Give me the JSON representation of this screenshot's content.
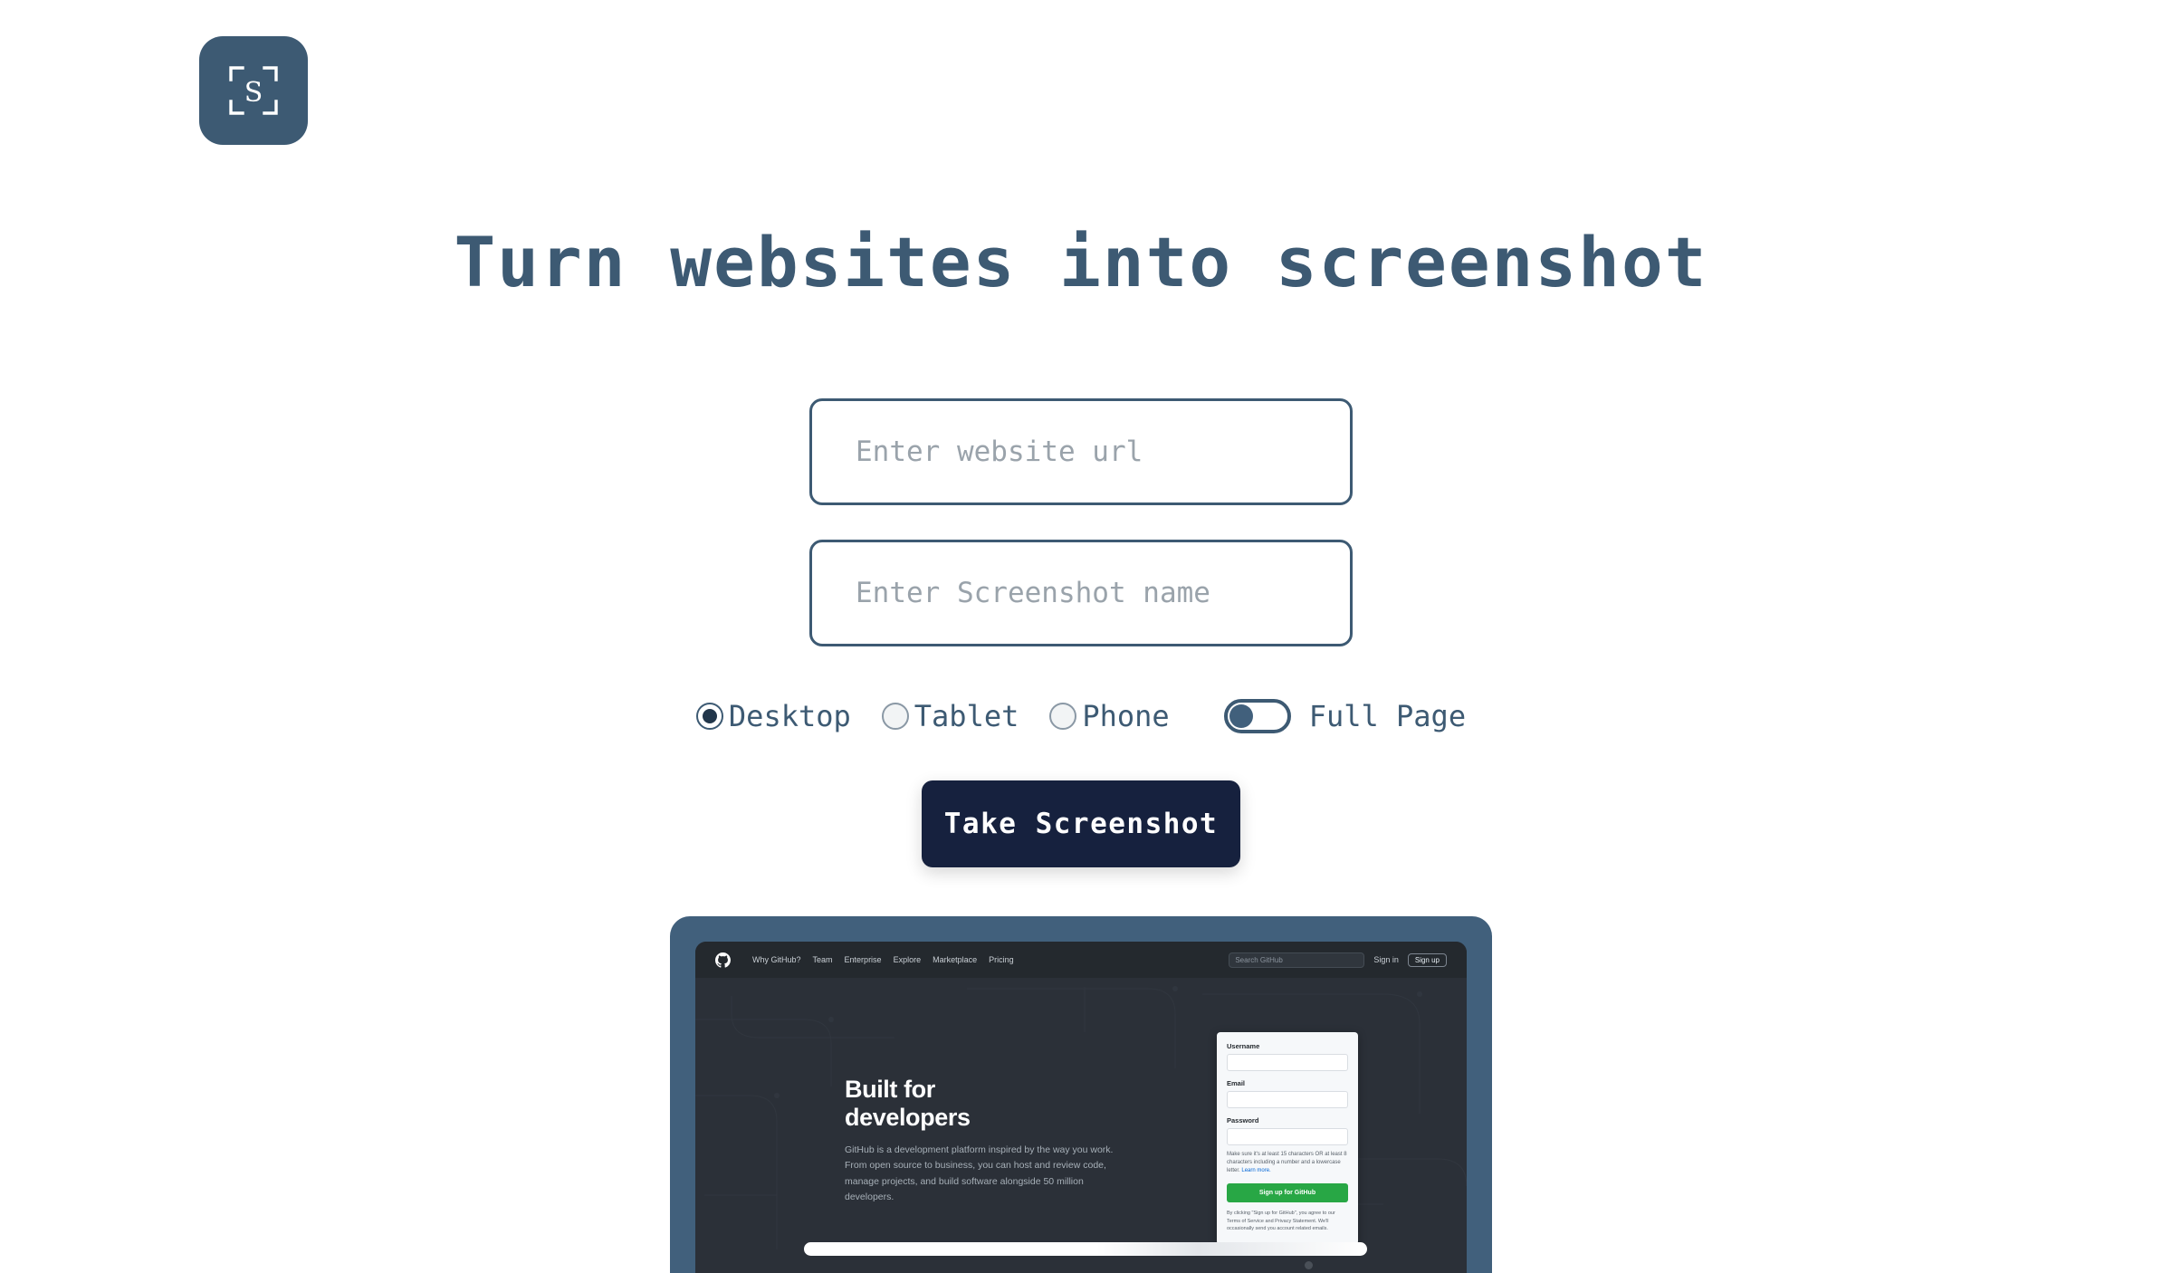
{
  "brand": {
    "logo_icon": "screenshot-capture-logo-icon",
    "logo_letter": "S",
    "logo_bg": "#3d5a73"
  },
  "hero": {
    "headline": "Turn websites into screenshot",
    "headline_color": "#3d5a73"
  },
  "form": {
    "url_input": {
      "value": "",
      "placeholder": "Enter website url"
    },
    "name_input": {
      "value": "",
      "placeholder": "Enter Screenshot name"
    },
    "device_options": [
      {
        "label": "Desktop",
        "selected": true
      },
      {
        "label": "Tablet",
        "selected": false
      },
      {
        "label": "Phone",
        "selected": false
      }
    ],
    "full_page_toggle": {
      "label": "Full Page",
      "on": false
    },
    "submit_label": "Take Screenshot",
    "submit_bg": "#16213e"
  },
  "preview": {
    "frame_color": "#41607c",
    "site": {
      "nav": {
        "logo_icon": "github-octocat-icon",
        "links": [
          "Why GitHub?",
          "Team",
          "Enterprise",
          "Explore",
          "Marketplace",
          "Pricing"
        ],
        "search_placeholder": "Search GitHub",
        "sign_in": "Sign in",
        "sign_up": "Sign up"
      },
      "hero": {
        "title_line1": "Built for",
        "title_line2": "developers",
        "body": "GitHub is a development platform inspired by the way you work. From open source to business, you can host and review code, manage projects, and build software alongside 50 million developers."
      },
      "signup_card": {
        "username_label": "Username",
        "email_label": "Email",
        "password_label": "Password",
        "password_help": "Make sure it's at least 15 characters OR at least 8 characters including a number and a lowercase letter.",
        "password_help_link": "Learn more.",
        "submit_label": "Sign up for GitHub",
        "submit_color": "#28a745",
        "terms": "By clicking \"Sign up for GitHub\", you agree to our Terms of Service and Privacy Statement. We'll occasionally send you account related emails."
      }
    }
  }
}
